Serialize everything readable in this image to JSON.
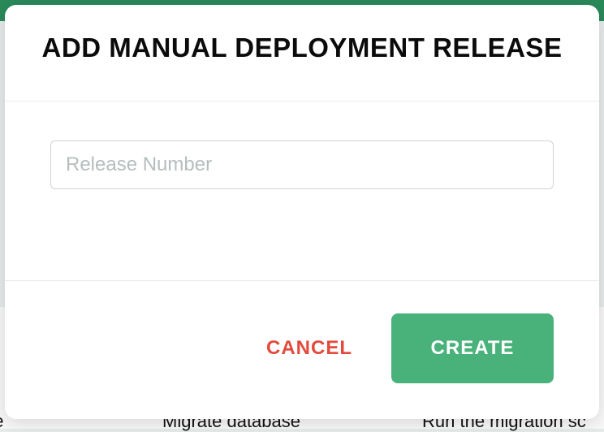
{
  "modal": {
    "title": "ADD MANUAL DEPLOYMENT RELEASE",
    "input": {
      "placeholder": "Release Number",
      "value": ""
    },
    "cancel_label": "CANCEL",
    "create_label": "CREATE"
  },
  "background": {
    "col1_text": "rvice",
    "col2_text": "Migrate database",
    "col3_text": "Run the migration sc"
  },
  "colors": {
    "top_bar": "#2a8a5a",
    "create_button": "#48b27a",
    "cancel_text": "#e34a3b"
  }
}
